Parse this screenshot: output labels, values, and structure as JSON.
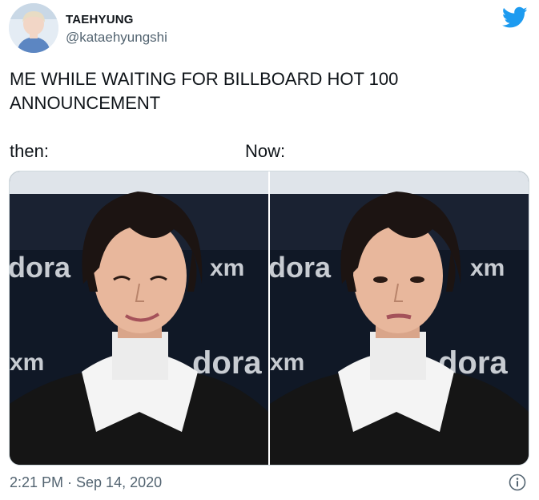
{
  "author": {
    "name": "TAEHYUNG",
    "handle": "@kataehyungshi",
    "avatar_icon": "profile-photo-avatar"
  },
  "brand": {
    "icon": "twitter-bird-icon",
    "color": "#1d9bf0"
  },
  "tweet": {
    "text": "ME WHILE WAITING FOR BILLBOARD HOT 100 ANNOUNCEMENT",
    "captions": {
      "left": "then:",
      "right": "Now:"
    },
    "media": [
      {
        "expression": "smiling",
        "backdrop_text": [
          "dora",
          "xm",
          "dora",
          "xm"
        ]
      },
      {
        "expression": "neutral",
        "backdrop_text": [
          "dora",
          "xm",
          "dora",
          "xm"
        ]
      }
    ],
    "timestamp": "2:21 PM · Sep 14, 2020"
  },
  "actions": {
    "info_icon": "info-icon"
  }
}
